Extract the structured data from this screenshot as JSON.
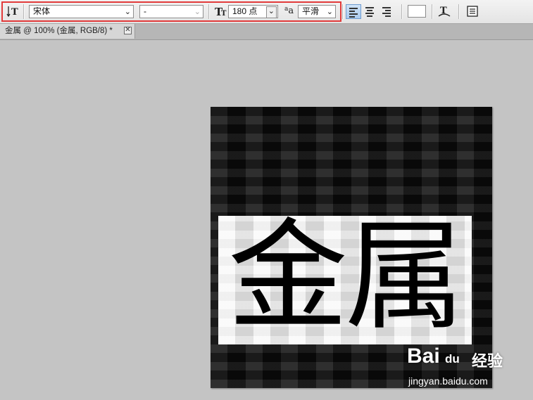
{
  "toolbar": {
    "font_family": "宋体",
    "font_style": "-",
    "font_size": "180 点",
    "aa_icon_text": "a",
    "aa_icon_text_big": "a",
    "antialias": "平滑",
    "color_accent": "#e23b3b"
  },
  "tab": {
    "title": "金属 @ 100% (金属, RGB/8) *",
    "close_glyph": "✕"
  },
  "canvas": {
    "text": "金属"
  },
  "watermark": {
    "logo": "Bai",
    "logo_suffix": "du",
    "brand_cn": "经验",
    "url": "jingyan.baidu.com"
  },
  "icons": {
    "orient": "text-orientation-icon",
    "font_size": "font-size-icon",
    "antialias": "antialias-icon",
    "align_left": "align-left-icon",
    "align_center": "align-center-icon",
    "align_right": "align-right-icon",
    "color": "text-color-swatch",
    "warp": "warp-text-icon",
    "panels": "character-panel-icon"
  }
}
